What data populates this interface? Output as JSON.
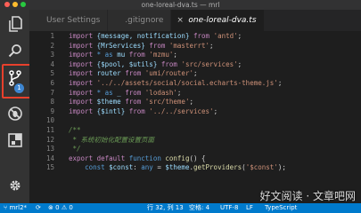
{
  "window": {
    "title": "one-loreal-dva.ts — mrl"
  },
  "tabs": [
    {
      "label": "User Settings"
    },
    {
      "label": ".gitignore"
    },
    {
      "label": "one-loreal-dva.ts"
    }
  ],
  "activity_bar": {
    "scm_badge": "1"
  },
  "editor": {
    "lines": [
      {
        "n": "1",
        "code": [
          [
            "kwc",
            "import "
          ],
          [
            "id",
            "{message, notification}"
          ],
          [
            "kwc",
            " from "
          ],
          [
            "str",
            "'antd'"
          ],
          [
            "p",
            ";"
          ]
        ]
      },
      {
        "n": "2",
        "code": [
          [
            "kwc",
            "import "
          ],
          [
            "id",
            "{MrServices}"
          ],
          [
            "kwc",
            " from "
          ],
          [
            "str",
            "'masterrt'"
          ],
          [
            "p",
            ";"
          ]
        ]
      },
      {
        "n": "3",
        "code": [
          [
            "kwc",
            "import "
          ],
          [
            "kw",
            "* as "
          ],
          [
            "id",
            "mu"
          ],
          [
            "kwc",
            " from "
          ],
          [
            "str",
            "'mzmu'"
          ],
          [
            "p",
            ";"
          ]
        ]
      },
      {
        "n": "4",
        "code": [
          [
            "kwc",
            "import "
          ],
          [
            "id",
            "{$pool, $utils}"
          ],
          [
            "kwc",
            " from "
          ],
          [
            "str",
            "'src/services'"
          ],
          [
            "p",
            ";"
          ]
        ]
      },
      {
        "n": "5",
        "code": [
          [
            "kwc",
            "import "
          ],
          [
            "id",
            "router"
          ],
          [
            "kwc",
            " from "
          ],
          [
            "str",
            "'umi/router'"
          ],
          [
            "p",
            ";"
          ]
        ]
      },
      {
        "n": "6",
        "code": [
          [
            "kwc",
            "import "
          ],
          [
            "str",
            "'../../assets/social/social.echarts-theme.js'"
          ],
          [
            "p",
            ";"
          ]
        ]
      },
      {
        "n": "7",
        "code": [
          [
            "kwc",
            "import "
          ],
          [
            "kw",
            "* as "
          ],
          [
            "id",
            "_"
          ],
          [
            "kwc",
            " from "
          ],
          [
            "str",
            "'lodash'"
          ],
          [
            "p",
            ";"
          ]
        ]
      },
      {
        "n": "8",
        "code": [
          [
            "kwc",
            "import "
          ],
          [
            "id",
            "$theme"
          ],
          [
            "kwc",
            " from "
          ],
          [
            "str",
            "'src/theme'"
          ],
          [
            "p",
            ";"
          ]
        ]
      },
      {
        "n": "9",
        "code": [
          [
            "kwc",
            "import "
          ],
          [
            "id",
            "{$intl}"
          ],
          [
            "kwc",
            " from "
          ],
          [
            "str",
            "'../../services'"
          ],
          [
            "p",
            ";"
          ]
        ]
      },
      {
        "n": "10",
        "code": []
      },
      {
        "n": "11",
        "code": [
          [
            "cm",
            "/**"
          ]
        ]
      },
      {
        "n": "12",
        "code": [
          [
            "cm",
            " * 系统初始化配置设置页面"
          ]
        ]
      },
      {
        "n": "13",
        "code": [
          [
            "cm",
            " */"
          ]
        ]
      },
      {
        "n": "14",
        "code": [
          [
            "kwc",
            "export "
          ],
          [
            "kwc",
            "default "
          ],
          [
            "kw",
            "function "
          ],
          [
            "fn",
            "config"
          ],
          [
            "p",
            "() {"
          ]
        ]
      },
      {
        "n": "15",
        "code": [
          [
            "p",
            "    "
          ],
          [
            "kw",
            "const "
          ],
          [
            "id",
            "$const"
          ],
          [
            "p",
            ": "
          ],
          [
            "kw",
            "any"
          ],
          [
            "p",
            " = "
          ],
          [
            "id",
            "$theme"
          ],
          [
            "p",
            "."
          ],
          [
            "fn",
            "getProviders"
          ],
          [
            "p",
            "("
          ],
          [
            "str",
            "'$const'"
          ],
          [
            "p",
            ");"
          ]
        ]
      }
    ]
  },
  "status_bar": {
    "branch": "mrl2*",
    "position": "行 32, 列 13",
    "indent": "空格: 4",
    "encoding": "UTF-8",
    "eol": "LF",
    "language": "TypeScript",
    "errors": "0",
    "warnings": "0"
  },
  "watermark": "好文阅读 · 文章吧网"
}
